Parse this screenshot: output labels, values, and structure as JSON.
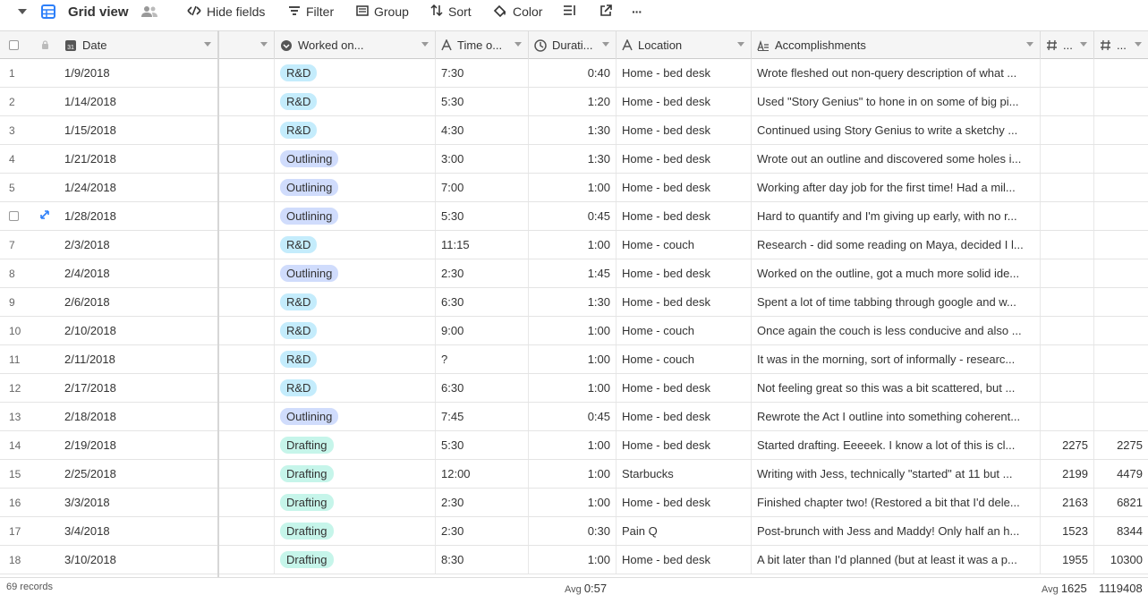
{
  "toolbar": {
    "view_name": "Grid view",
    "hide_fields": "Hide fields",
    "filter": "Filter",
    "group": "Group",
    "sort": "Sort",
    "color": "Color",
    "more": "···"
  },
  "columns": {
    "date": "Date",
    "worked_on": "Worked on...",
    "time_of": "Time o...",
    "duration": "Durati...",
    "location": "Location",
    "accomplishments": "Accomplishments",
    "num1": "...",
    "num2": "..."
  },
  "tag_colors": {
    "R&D": "#c4ecfc",
    "Outlining": "#d0dcfc",
    "Drafting": "#c6f5ea"
  },
  "rows": [
    {
      "n": "1",
      "date": "1/9/2018",
      "tag": "R&D",
      "time": "7:30",
      "dur": "0:40",
      "loc": "Home - bed desk",
      "acc": "Wrote fleshed out non-query description of what ...",
      "w1": "",
      "w2": ""
    },
    {
      "n": "2",
      "date": "1/14/2018",
      "tag": "R&D",
      "time": "5:30",
      "dur": "1:20",
      "loc": "Home - bed desk",
      "acc": "Used \"Story Genius\" to hone in on some of big pi...",
      "w1": "",
      "w2": ""
    },
    {
      "n": "3",
      "date": "1/15/2018",
      "tag": "R&D",
      "time": "4:30",
      "dur": "1:30",
      "loc": "Home - bed desk",
      "acc": "Continued using Story Genius to write a sketchy ...",
      "w1": "",
      "w2": ""
    },
    {
      "n": "4",
      "date": "1/21/2018",
      "tag": "Outlining",
      "time": "3:00",
      "dur": "1:30",
      "loc": "Home - bed desk",
      "acc": "Wrote out an outline and discovered some holes i...",
      "w1": "",
      "w2": ""
    },
    {
      "n": "5",
      "date": "1/24/2018",
      "tag": "Outlining",
      "time": "7:00",
      "dur": "1:00",
      "loc": "Home - bed desk",
      "acc": "Working after day job for the first time! Had a mil...",
      "w1": "",
      "w2": ""
    },
    {
      "n": "",
      "date": "1/28/2018",
      "tag": "Outlining",
      "time": "5:30",
      "dur": "0:45",
      "loc": "Home - bed desk",
      "acc": "Hard to quantify and I'm giving up early, with no r...",
      "w1": "",
      "w2": ""
    },
    {
      "n": "7",
      "date": "2/3/2018",
      "tag": "R&D",
      "time": "11:15",
      "dur": "1:00",
      "loc": "Home - couch",
      "acc": "Research - did some reading on Maya, decided I l...",
      "w1": "",
      "w2": ""
    },
    {
      "n": "8",
      "date": "2/4/2018",
      "tag": "Outlining",
      "time": "2:30",
      "dur": "1:45",
      "loc": "Home - bed desk",
      "acc": "Worked on the outline, got a much more solid ide...",
      "w1": "",
      "w2": ""
    },
    {
      "n": "9",
      "date": "2/6/2018",
      "tag": "R&D",
      "time": "6:30",
      "dur": "1:30",
      "loc": "Home - bed desk",
      "acc": "Spent a lot of time tabbing through google and w...",
      "w1": "",
      "w2": ""
    },
    {
      "n": "10",
      "date": "2/10/2018",
      "tag": "R&D",
      "time": "9:00",
      "dur": "1:00",
      "loc": "Home - couch",
      "acc": "Once again the couch is less conducive and also ...",
      "w1": "",
      "w2": ""
    },
    {
      "n": "11",
      "date": "2/11/2018",
      "tag": "R&D",
      "time": "?",
      "dur": "1:00",
      "loc": "Home - couch",
      "acc": "It was in the morning, sort of informally - researc...",
      "w1": "",
      "w2": ""
    },
    {
      "n": "12",
      "date": "2/17/2018",
      "tag": "R&D",
      "time": "6:30",
      "dur": "1:00",
      "loc": "Home - bed desk",
      "acc": "Not feeling great so this was a bit scattered, but ...",
      "w1": "",
      "w2": ""
    },
    {
      "n": "13",
      "date": "2/18/2018",
      "tag": "Outlining",
      "time": "7:45",
      "dur": "0:45",
      "loc": "Home - bed desk",
      "acc": "Rewrote the Act I outline into something coherent...",
      "w1": "",
      "w2": ""
    },
    {
      "n": "14",
      "date": "2/19/2018",
      "tag": "Drafting",
      "time": "5:30",
      "dur": "1:00",
      "loc": "Home - bed desk",
      "acc": "Started drafting. Eeeeek. I know a lot of this is cl...",
      "w1": "2275",
      "w2": "2275"
    },
    {
      "n": "15",
      "date": "2/25/2018",
      "tag": "Drafting",
      "time": "12:00",
      "dur": "1:00",
      "loc": "Starbucks",
      "acc": "Writing with Jess, technically \"started\" at 11 but ...",
      "w1": "2199",
      "w2": "4479"
    },
    {
      "n": "16",
      "date": "3/3/2018",
      "tag": "Drafting",
      "time": "2:30",
      "dur": "1:00",
      "loc": "Home - bed desk",
      "acc": "Finished chapter two! (Restored a bit that I'd dele...",
      "w1": "2163",
      "w2": "6821"
    },
    {
      "n": "17",
      "date": "3/4/2018",
      "tag": "Drafting",
      "time": "2:30",
      "dur": "0:30",
      "loc": "Pain Q",
      "acc": "Post-brunch with Jess and Maddy! Only half an h...",
      "w1": "1523",
      "w2": "8344"
    },
    {
      "n": "18",
      "date": "3/10/2018",
      "tag": "Drafting",
      "time": "8:30",
      "dur": "1:00",
      "loc": "Home - bed desk",
      "acc": "A bit later than I'd planned (but at least it was a p...",
      "w1": "1955",
      "w2": "10300"
    }
  ],
  "footer": {
    "records": "69 records",
    "avg_label": "Avg",
    "avg_duration": "0:57",
    "avg_label2": "Avg",
    "avg_words": "1625",
    "sum_words": "1119408"
  }
}
